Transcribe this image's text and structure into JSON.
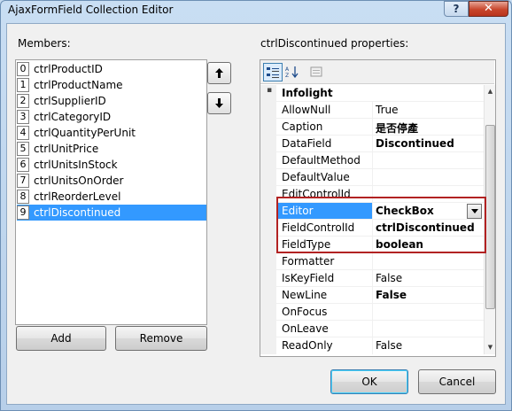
{
  "window": {
    "title": "AjaxFormField Collection Editor",
    "help_label": "?",
    "close_label": "✕"
  },
  "members_label": "Members:",
  "members": [
    {
      "index": "0",
      "name": "ctrlProductID"
    },
    {
      "index": "1",
      "name": "ctrlProductName"
    },
    {
      "index": "2",
      "name": "ctrlSupplierID"
    },
    {
      "index": "3",
      "name": "ctrlCategoryID"
    },
    {
      "index": "4",
      "name": "ctrlQuantityPerUnit"
    },
    {
      "index": "5",
      "name": "ctrlUnitPrice"
    },
    {
      "index": "6",
      "name": "ctrlUnitsInStock"
    },
    {
      "index": "7",
      "name": "ctrlUnitsOnOrder"
    },
    {
      "index": "8",
      "name": "ctrlReorderLevel"
    },
    {
      "index": "9",
      "name": "ctrlDiscontinued"
    }
  ],
  "selected_member": "ctrlDiscontinued",
  "move_up_icon": "arrow-up-icon",
  "move_down_icon": "arrow-down-icon",
  "buttons": {
    "add": "Add",
    "remove": "Remove",
    "ok": "OK",
    "cancel": "Cancel"
  },
  "properties_label": "ctrlDiscontinued properties:",
  "toolbar": {
    "categorized_icon": "categorized-icon",
    "alphabetical_icon": "alphabetical-icon",
    "pages_icon": "property-pages-icon"
  },
  "category": {
    "expander": "▪",
    "name": "Infolight"
  },
  "properties": [
    {
      "name": "AllowNull",
      "value": "True"
    },
    {
      "name": "Caption",
      "value": "是否停產"
    },
    {
      "name": "DataField",
      "value": "Discontinued"
    },
    {
      "name": "DefaultMethod",
      "value": ""
    },
    {
      "name": "DefaultValue",
      "value": ""
    },
    {
      "name": "EditControlId",
      "value": ""
    },
    {
      "name": "Editor",
      "value": "CheckBox"
    },
    {
      "name": "FieldControlId",
      "value": "ctrlDiscontinued"
    },
    {
      "name": "FieldType",
      "value": "boolean"
    },
    {
      "name": "Formatter",
      "value": ""
    },
    {
      "name": "IsKeyField",
      "value": "False"
    },
    {
      "name": "NewLine",
      "value": "False"
    },
    {
      "name": "OnFocus",
      "value": ""
    },
    {
      "name": "OnLeave",
      "value": ""
    },
    {
      "name": "ReadOnly",
      "value": "False"
    }
  ],
  "selected_property": "Editor",
  "colors": {
    "selection": "#3399ff",
    "highlight_border": "#b22222",
    "window_frame": "#c6dbf1"
  }
}
